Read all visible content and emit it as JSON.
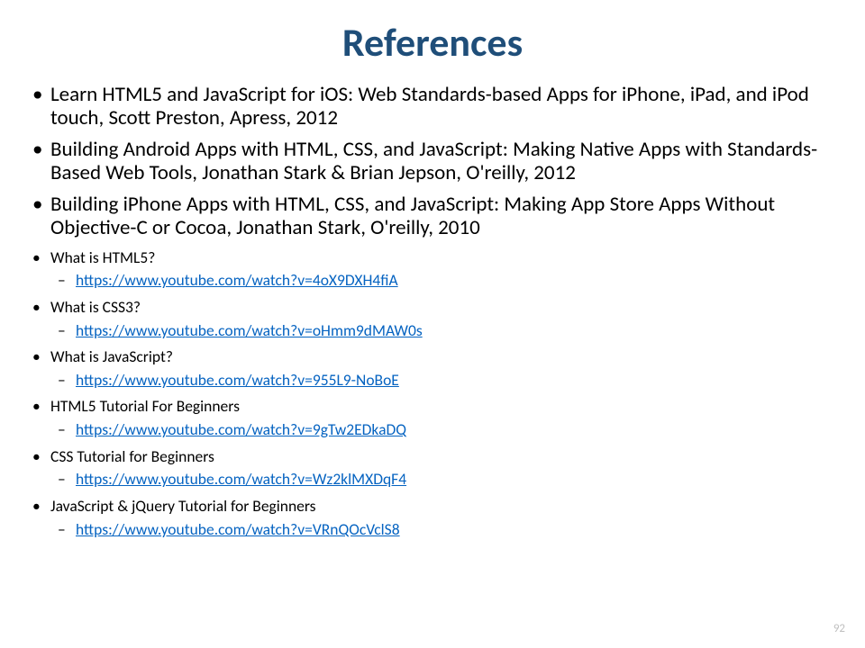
{
  "title": "References",
  "page_number": "92",
  "bullets": [
    {
      "kind": "large",
      "text": "Learn HTML5 and JavaScript for iOS: Web Standards-based Apps for iPhone, iPad, and iPod touch, Scott Preston, Apress, 2012"
    },
    {
      "kind": "large",
      "text": "Building Android Apps with HTML, CSS, and JavaScript: Making Native Apps with Standards-Based Web Tools, Jonathan Stark & Brian Jepson, O'reilly, 2012"
    },
    {
      "kind": "large",
      "text": "Building iPhone Apps with HTML, CSS, and JavaScript: Making App Store Apps Without Objective-C or Cocoa, Jonathan Stark, O'reilly, 2010"
    },
    {
      "kind": "small",
      "text": "What is HTML5?",
      "link": "https://www.youtube.com/watch?v=4oX9DXH4fiA"
    },
    {
      "kind": "small",
      "text": "What is CSS3?",
      "link": "https://www.youtube.com/watch?v=oHmm9dMAW0s"
    },
    {
      "kind": "small",
      "text": "What is JavaScript?",
      "link": "https://www.youtube.com/watch?v=955L9-NoBoE"
    },
    {
      "kind": "small",
      "text": "HTML5 Tutorial For Beginners",
      "link": "https://www.youtube.com/watch?v=9gTw2EDkaDQ"
    },
    {
      "kind": "small",
      "text": "CSS Tutorial for Beginners",
      "link": "https://www.youtube.com/watch?v=Wz2klMXDqF4"
    },
    {
      "kind": "small",
      "text": "JavaScript & jQuery Tutorial for Beginners",
      "link": "https://www.youtube.com/watch?v=VRnQOcVclS8"
    }
  ]
}
